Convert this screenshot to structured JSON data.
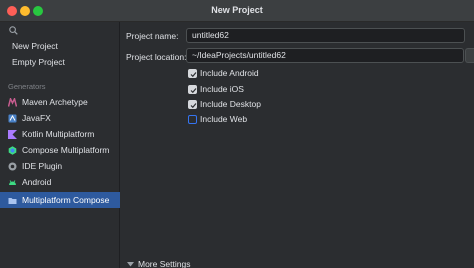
{
  "window": {
    "title": "New Project",
    "controls": {
      "close_color": "#fe5f57",
      "minimize_color": "#febc2e",
      "zoom_color": "#28c840"
    }
  },
  "sidebar": {
    "search_icon": "search-icon",
    "top_items": [
      {
        "label": "New Project"
      },
      {
        "label": "Empty Project"
      }
    ],
    "section_label": "Generators",
    "generators": [
      {
        "label": "Maven Archetype",
        "icon": "maven-icon"
      },
      {
        "label": "JavaFX",
        "icon": "javafx-icon"
      },
      {
        "label": "Kotlin Multiplatform",
        "icon": "kotlin-icon"
      },
      {
        "label": "Compose Multiplatform",
        "icon": "compose-icon"
      },
      {
        "label": "IDE Plugin",
        "icon": "plugin-icon"
      },
      {
        "label": "Android",
        "icon": "android-icon"
      },
      {
        "label": "Multiplatform Compose",
        "icon": "folder-icon",
        "selected": true
      }
    ]
  },
  "form": {
    "name_label": "Project name:",
    "name_value": "untitled62",
    "location_label": "Project location:",
    "location_value": "~/IdeaProjects/untitled62",
    "options": [
      {
        "label": "Include Android",
        "checked": true
      },
      {
        "label": "Include iOS",
        "checked": true
      },
      {
        "label": "Include Desktop",
        "checked": true
      },
      {
        "label": "Include Web",
        "checked": false
      }
    ],
    "more_settings_label": "More Settings"
  },
  "colors": {
    "accent": "#3574f0",
    "selection": "#2e5a9e",
    "background": "#2b2d30"
  }
}
